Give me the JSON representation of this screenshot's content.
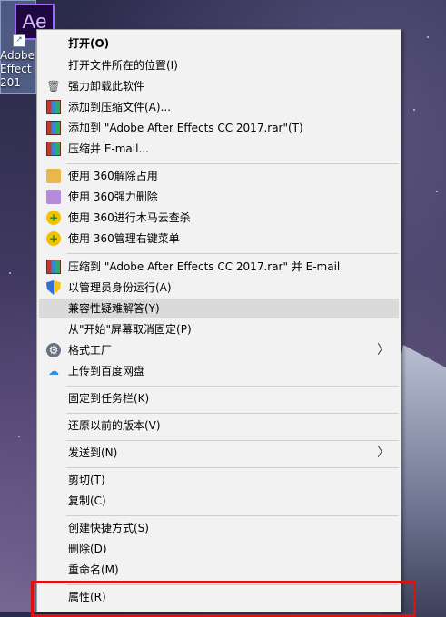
{
  "desktop": {
    "icon_label_lines": [
      "Adobe",
      "Effect",
      "201"
    ],
    "logo_text": "Ae"
  },
  "menu": {
    "items": [
      {
        "label": "打开(O)"
      },
      {
        "label": "打开文件所在的位置(I)"
      },
      {
        "label": "强力卸载此软件",
        "icon": "trash-icon"
      },
      {
        "label": "添加到压缩文件(A)...",
        "icon": "winrar-icon"
      },
      {
        "label": "添加到 \"Adobe After Effects CC 2017.rar\"(T)",
        "icon": "winrar-icon"
      },
      {
        "label": "压缩并 E-mail...",
        "icon": "winrar-icon"
      },
      {
        "label": "使用 360解除占用",
        "icon": "360-unlock-icon"
      },
      {
        "label": "使用 360强力删除",
        "icon": "360-delete-icon"
      },
      {
        "label": "使用 360进行木马云查杀",
        "icon": "360-scan-icon"
      },
      {
        "label": "使用 360管理右键菜单",
        "icon": "360-menu-icon"
      },
      {
        "label": "压缩到 \"Adobe After Effects CC 2017.rar\" 并 E-mail",
        "icon": "winrar-icon"
      },
      {
        "label": "以管理员身份运行(A)",
        "icon": "uac-shield-icon"
      },
      {
        "label": "兼容性疑难解答(Y)"
      },
      {
        "label": "从\"开始\"屏幕取消固定(P)"
      },
      {
        "label": "格式工厂",
        "icon": "format-factory-icon"
      },
      {
        "label": "上传到百度网盘",
        "icon": "baidu-cloud-icon"
      },
      {
        "label": "固定到任务栏(K)"
      },
      {
        "label": "还原以前的版本(V)"
      },
      {
        "label": "发送到(N)"
      },
      {
        "label": "剪切(T)"
      },
      {
        "label": "复制(C)"
      },
      {
        "label": "创建快捷方式(S)"
      },
      {
        "label": "删除(D)"
      },
      {
        "label": "重命名(M)"
      },
      {
        "label": "属性(R)"
      }
    ],
    "submenu_arrow": "〉"
  },
  "colors": {
    "menu_bg": "#f2f2f2",
    "hover_bg": "#dadada",
    "highlight_box": "#e01010"
  }
}
